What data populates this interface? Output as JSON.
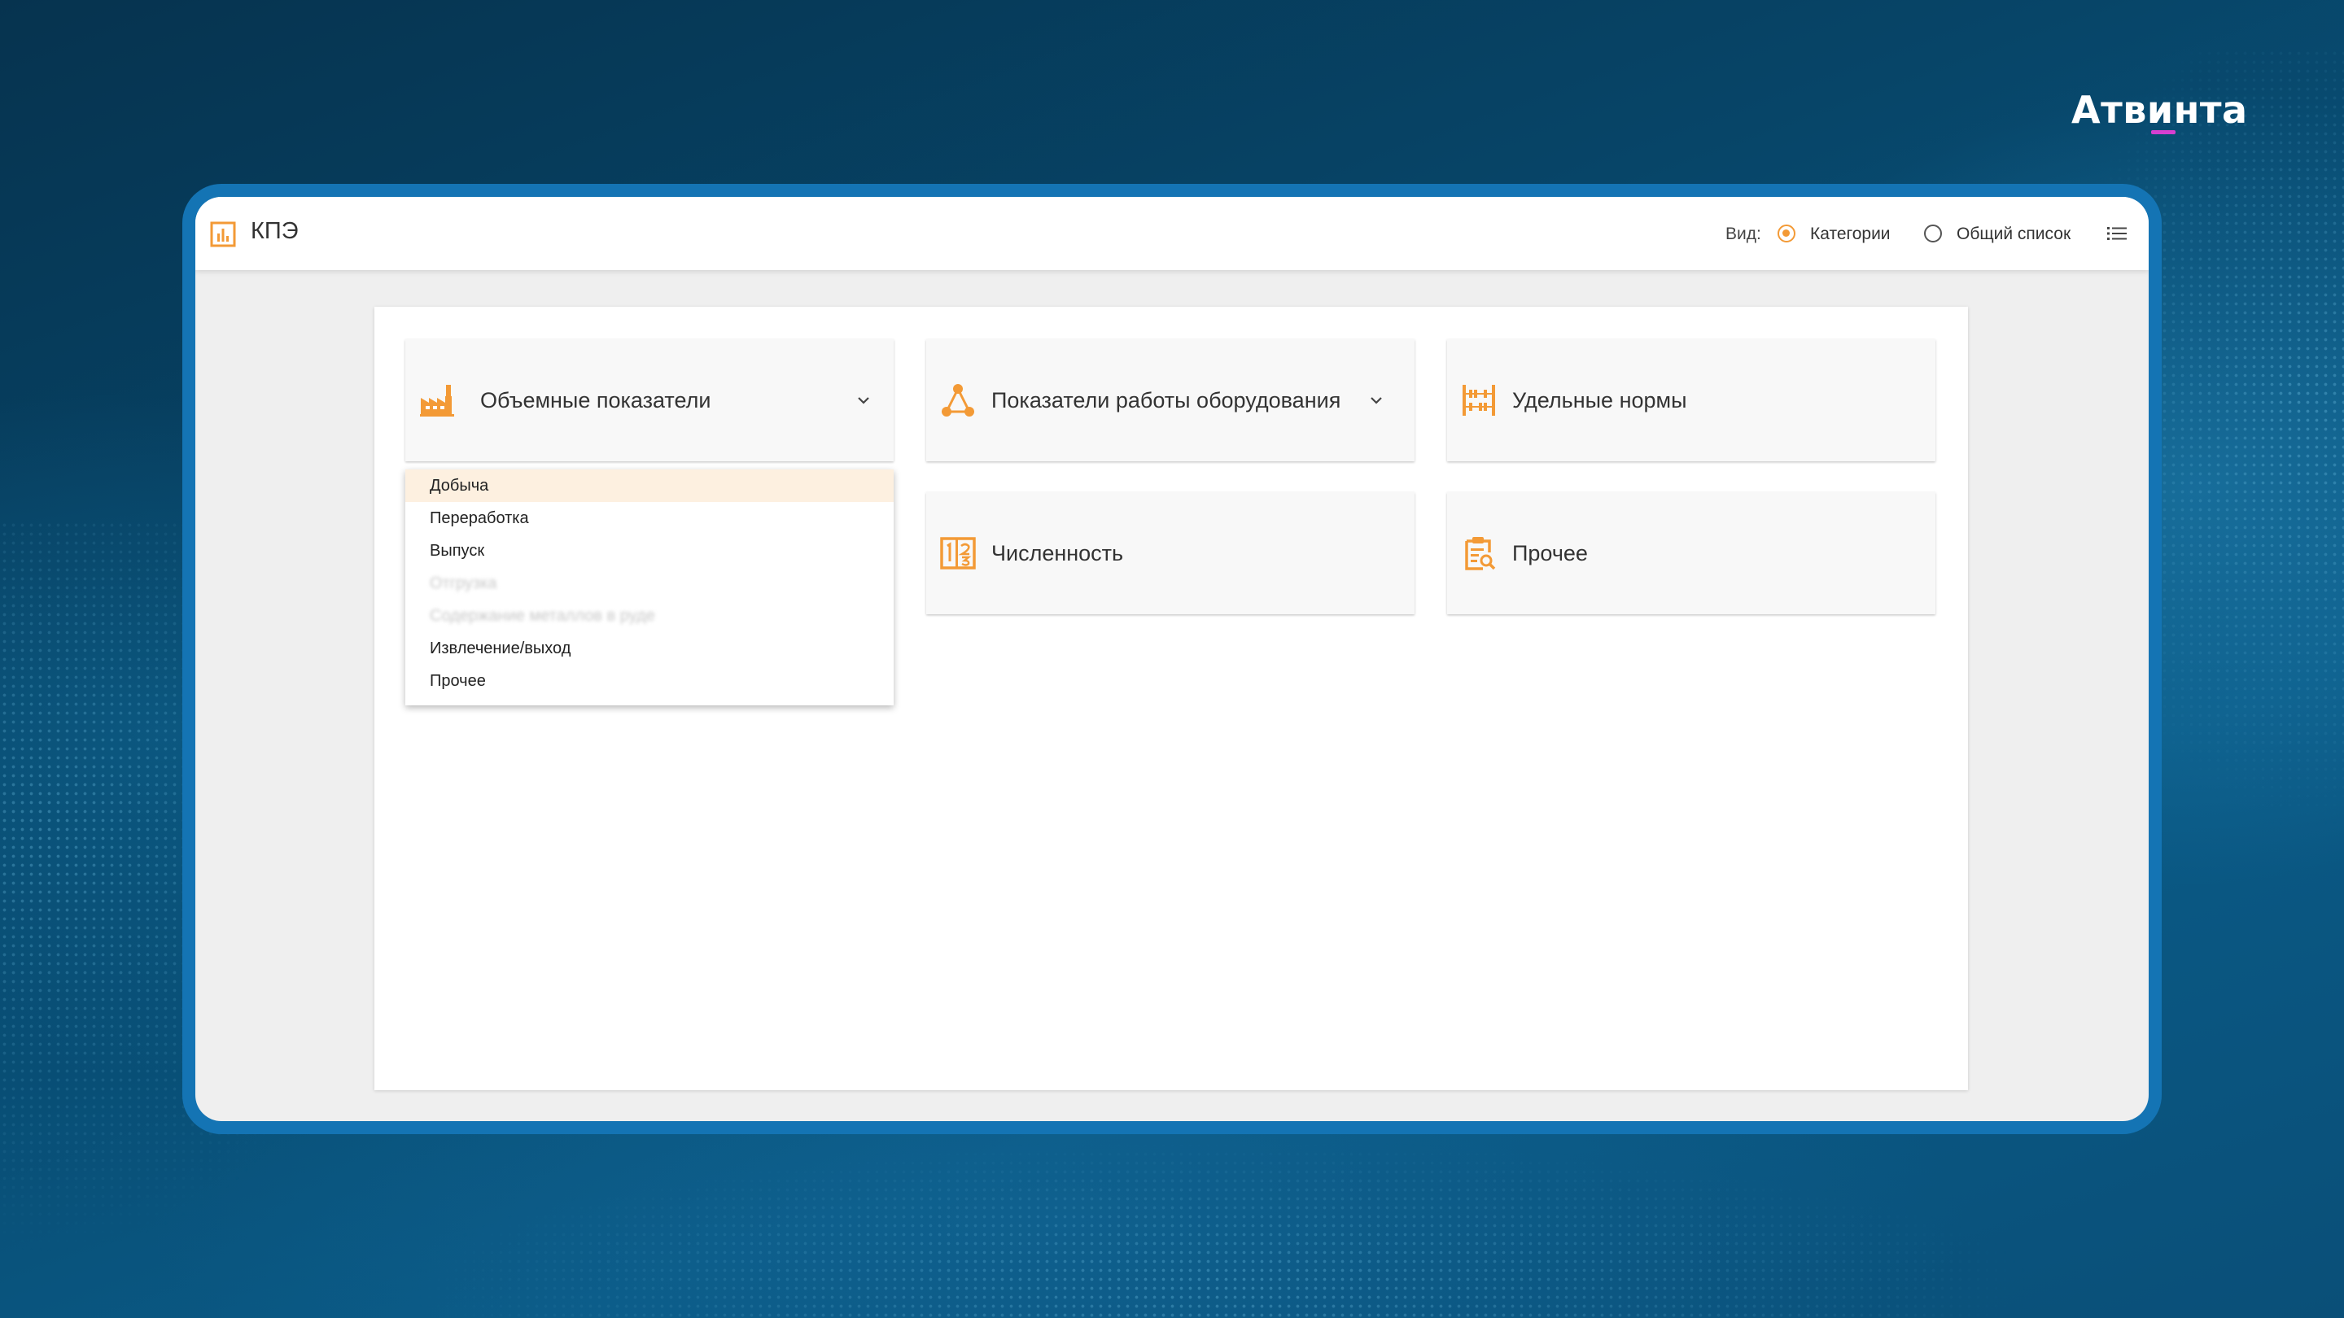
{
  "brand": {
    "name": "Атвинта"
  },
  "app": {
    "title": "КПЭ"
  },
  "view_switch": {
    "label": "Вид:",
    "options": [
      {
        "label": "Категории",
        "selected": true
      },
      {
        "label": "Общий список",
        "selected": false
      }
    ]
  },
  "categories": [
    {
      "title": "Объемные показатели",
      "icon": "factory-icon",
      "expandable": true,
      "expanded": true
    },
    {
      "title": "Показатели работы оборудования",
      "icon": "network-nodes-icon",
      "expandable": true,
      "expanded": false
    },
    {
      "title": "Удельные нормы",
      "icon": "abacus-icon",
      "expandable": false
    },
    {
      "title": "Численность",
      "icon": "numbers-icon",
      "expandable": false
    },
    {
      "title": "Прочее",
      "icon": "clipboard-search-icon",
      "expandable": false
    }
  ],
  "dropdown": {
    "items": [
      {
        "label": "Добыча",
        "state": "active"
      },
      {
        "label": "Переработка",
        "state": "normal"
      },
      {
        "label": "Выпуск",
        "state": "normal"
      },
      {
        "label": "Отгрузка",
        "state": "blurred"
      },
      {
        "label": "Содержание металлов в руде",
        "state": "blurred"
      },
      {
        "label": "Извлечение/выход",
        "state": "normal"
      },
      {
        "label": "Прочее",
        "state": "normal"
      }
    ]
  },
  "colors": {
    "accent": "#f39a36",
    "frame": "#1474b4",
    "brand_underline": "#d63fd0"
  }
}
